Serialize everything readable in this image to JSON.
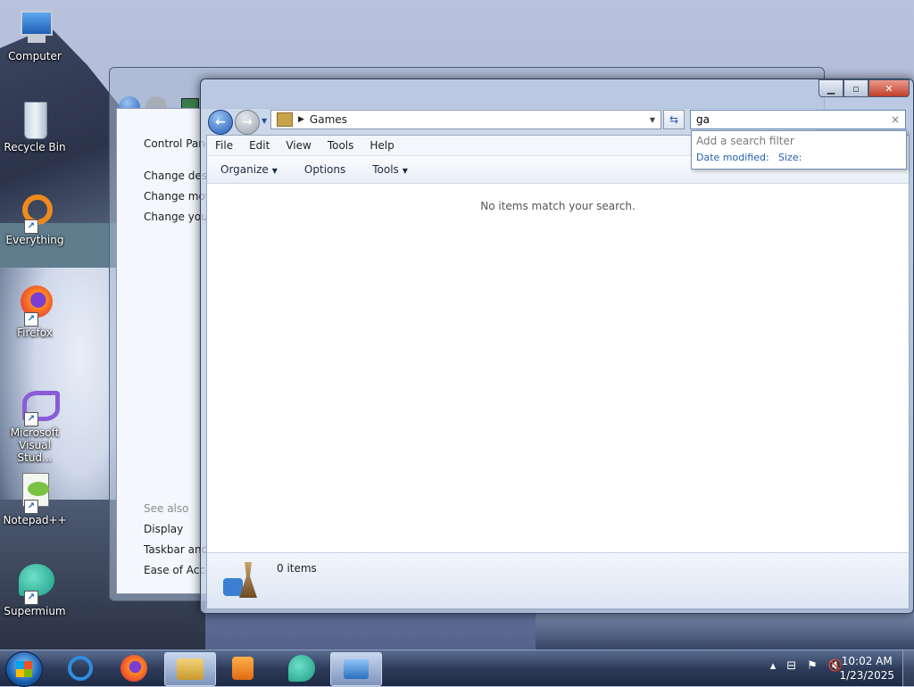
{
  "desktop": {
    "icons": [
      {
        "label": "Computer",
        "icon": "computer-icon"
      },
      {
        "label": "Recycle Bin",
        "icon": "recycle-bin-icon"
      },
      {
        "label": "Everything",
        "icon": "everything-icon"
      },
      {
        "label": "Firefox",
        "icon": "firefox-icon"
      },
      {
        "label": "Microsoft Visual Stud...",
        "icon": "visual-studio-icon"
      },
      {
        "label": "Notepad++",
        "icon": "notepad-plus-plus-icon"
      },
      {
        "label": "Supermium",
        "icon": "supermium-icon"
      }
    ]
  },
  "back_window": {
    "links": [
      "Control Pane",
      "Change desk",
      "Change mou",
      "Change you"
    ],
    "see_also_label": "See also",
    "see_also": [
      "Display",
      "Taskbar and",
      "Ease of Acce"
    ]
  },
  "explorer": {
    "address": {
      "crumb": "Games"
    },
    "search": {
      "value": "ga",
      "clear_glyph": "×"
    },
    "menus": [
      "File",
      "Edit",
      "View",
      "Tools",
      "Help"
    ],
    "commands": [
      {
        "label": "Organize",
        "has_dropdown": true
      },
      {
        "label": "Options",
        "has_dropdown": false
      },
      {
        "label": "Tools",
        "has_dropdown": true
      }
    ],
    "empty_message": "No items match your search.",
    "details": {
      "count": "0 items"
    },
    "search_suggest": {
      "title": "Add a search filter",
      "filters": [
        "Date modified:",
        "Size:"
      ]
    }
  },
  "taskbar": {
    "items": [
      "internet-explorer-icon",
      "firefox-icon",
      "explorer-icon",
      "media-player-icon",
      "supermium-icon",
      "control-panel-icon"
    ],
    "active_indices": [
      2,
      5
    ],
    "clock": {
      "time": "10:02 AM",
      "date": "1/23/2025"
    }
  },
  "colors": {
    "accent": "#1e5fb0",
    "close": "#c1402a"
  }
}
